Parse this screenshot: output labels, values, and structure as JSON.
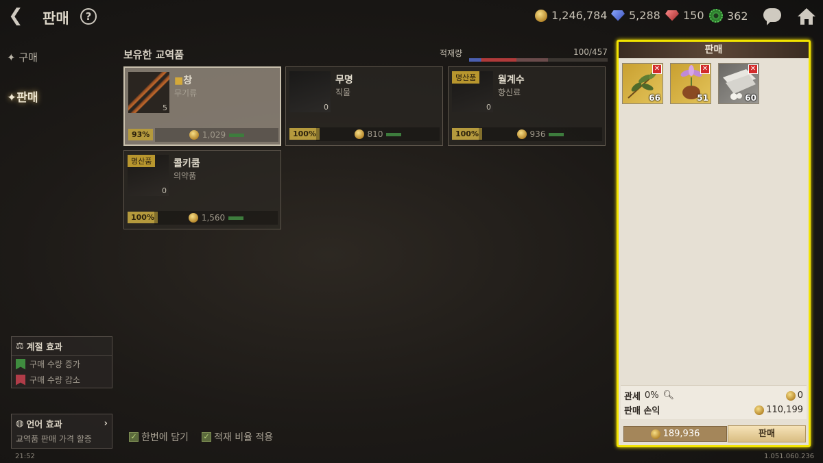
{
  "header": {
    "title": "판매",
    "help": "?",
    "currencies": [
      {
        "icon": "gold-coin-icon",
        "value": "1,246,784"
      },
      {
        "icon": "blue-gem-icon",
        "value": "5,288"
      },
      {
        "icon": "red-gem-icon",
        "value": "150"
      },
      {
        "icon": "green-gear-icon",
        "value": "362"
      }
    ]
  },
  "nav": {
    "items": [
      {
        "label": "구매",
        "active": false
      },
      {
        "label": "판매",
        "active": true
      }
    ]
  },
  "inventory": {
    "title": "보유한 교역품",
    "load_label": "적재량",
    "load_value": "100/457",
    "load_ratio": 0.219,
    "cards": [
      {
        "name": "창",
        "category": "무기류",
        "qty": "5",
        "percent": "93%",
        "price": "1,029",
        "special": false
      },
      {
        "name": "무명",
        "category": "직물",
        "qty": "0",
        "percent": "100%",
        "price": "810",
        "special": false
      },
      {
        "name": "월계수",
        "category": "향신료",
        "qty": "0",
        "percent": "100%",
        "price": "936",
        "special": true
      },
      {
        "name": "콜키쿰",
        "category": "의약품",
        "qty": "0",
        "percent": "100%",
        "price": "1,560",
        "special": true
      }
    ],
    "special_label": "명산품"
  },
  "season": {
    "title": "계절 효과",
    "rows": [
      "구매 수량 증가",
      "구매 수량 감소"
    ]
  },
  "language": {
    "title": "언어 효과",
    "desc": "교역품 판매 가격 할증"
  },
  "options": {
    "load_all": "한번에 담기",
    "apply_ratio": "적재 비율 적용"
  },
  "sell": {
    "title": "판매",
    "items": [
      {
        "name": "laurel",
        "count": "66"
      },
      {
        "name": "colchicum",
        "count": "51"
      },
      {
        "name": "cotton",
        "count": "60"
      }
    ],
    "tax_label": "관세",
    "tax_rate": "0%",
    "tax_value": "0",
    "profit_label": "판매 손익",
    "profit_value": "110,199",
    "total": "189,936",
    "button": "판매"
  },
  "footer": {
    "clock": "21:52",
    "version": "1.051.060.236"
  },
  "colors": {
    "highlight": "#f2e400",
    "panel": "#e6e0d4",
    "gold": "#b59a3d"
  }
}
